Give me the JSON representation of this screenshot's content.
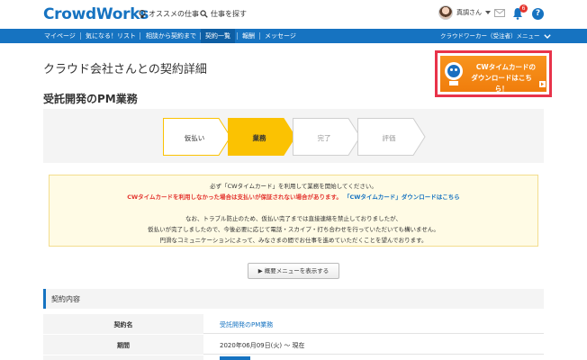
{
  "header": {
    "logo": "CrowdWorks",
    "nav_recommend": "オススメの仕事",
    "nav_search": "仕事を探す",
    "user_name": "真調さん",
    "notification_count": "6",
    "help": "?"
  },
  "navbar": {
    "items": [
      {
        "label": "マイページ"
      },
      {
        "label": "気になる！リスト"
      },
      {
        "label": "相談から契約まで"
      },
      {
        "label": "契約一覧"
      },
      {
        "label": "報酬"
      },
      {
        "label": "メッセージ"
      }
    ],
    "right_menu": "クラウドワーカー（受注者）メニュー"
  },
  "page": {
    "title": "クラウド会社さんとの契約詳細",
    "job_title": "受託開発のPM業務"
  },
  "banner": {
    "line1": "CWタイムカードの",
    "line2": "ダウンロードはこちら！"
  },
  "steps": [
    {
      "label": "仮払い",
      "state": "done"
    },
    {
      "label": "業務",
      "state": "current"
    },
    {
      "label": "完了",
      "state": "todo"
    },
    {
      "label": "評価",
      "state": "todo"
    }
  ],
  "notice": {
    "line1": "必ず「CWタイムカード」を利用して業務を開始してください。",
    "line2_red": "CWタイムカードを利用しなかった場合は支払いが保証されない場合があります。",
    "line2_link": "「CWタイムカード」ダウンロードはこちら",
    "line3": "なお、トラブル防止のため、仮払い完了までは直接連絡を禁止しておりましたが、",
    "line4": "仮払いが完了しましたので、今後必要に応じて電話・スカイプ・打ち合わせを行っていただいても構いません。",
    "line5": "円滑なコミュニケーションによって、みなさまの間でお仕事を進めていただくことを望んでおります。"
  },
  "detail_button": "▶ 概要メニューを表示する",
  "section": {
    "title": "契約内容"
  },
  "table": [
    {
      "label": "契約名",
      "value": "受託開発のPM業務"
    },
    {
      "label": "期間",
      "value": "2020年06月09日(火) 〜 現在"
    }
  ],
  "colors": {
    "brand_blue": "#1673c1",
    "step_active": "#fbc202",
    "banner_orange": "#f4891a",
    "highlight_red": "#e8334a"
  }
}
